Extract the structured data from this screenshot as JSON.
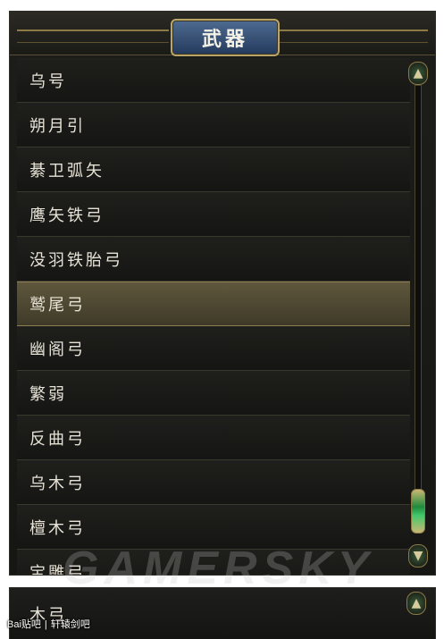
{
  "panel": {
    "title": "武器",
    "items": [
      {
        "label": "乌号"
      },
      {
        "label": "朔月引"
      },
      {
        "label": "綦卫弧矢"
      },
      {
        "label": "鹰矢铁弓"
      },
      {
        "label": "没羽铁胎弓"
      },
      {
        "label": "鹫尾弓"
      },
      {
        "label": "幽阁弓"
      },
      {
        "label": "繁弱"
      },
      {
        "label": "反曲弓"
      },
      {
        "label": "乌木弓"
      },
      {
        "label": "檀木弓"
      },
      {
        "label": "宝雕弓"
      }
    ],
    "selected_index": 5,
    "scroll": {
      "up_glyph": "▲",
      "down_glyph": "▼"
    }
  },
  "panel2": {
    "item_label": "木弓",
    "up_glyph": "▲"
  },
  "watermark": "GAMERSKY",
  "source": {
    "brand": "Bai",
    "channel": "贴吧",
    "forum": "轩辕剑吧"
  },
  "colors": {
    "title_plate": "#2f4a70",
    "selected_row": "#5a523a",
    "scroll_thumb": "#2fb158"
  },
  "icons": {
    "scroll_up": "up-arrow-icon",
    "scroll_down": "down-arrow-icon"
  }
}
